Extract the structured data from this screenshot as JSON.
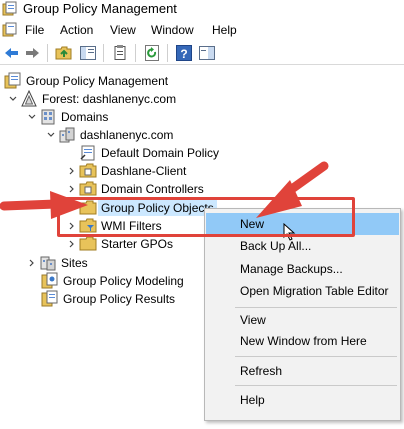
{
  "window": {
    "title": "Group Policy Management"
  },
  "menubar": {
    "items": [
      "File",
      "Action",
      "View",
      "Window",
      "Help"
    ]
  },
  "toolbar": {
    "icons": [
      "back-arrow-icon",
      "forward-arrow-icon",
      "up-folder-icon",
      "show-hide-tree-icon",
      "properties-icon",
      "refresh-icon",
      "help-icon",
      "action-pane-icon"
    ]
  },
  "tree": {
    "root": "Group Policy Management",
    "forest": "Forest: dashlanenyc.com",
    "domains": "Domains",
    "domain": "dashlanenyc.com",
    "default_policy": "Default Domain Policy",
    "dashlane_client": "Dashlane-Client",
    "domain_controllers": "Domain Controllers",
    "gpo": "Group Policy Objects",
    "wmi": "WMI Filters",
    "starter": "Starter GPOs",
    "sites": "Sites",
    "modeling": "Group Policy Modeling",
    "results": "Group Policy Results"
  },
  "context_menu": {
    "items": [
      "New",
      "Back Up All...",
      "Manage Backups...",
      "Open Migration Table Editor",
      "View",
      "New Window from Here",
      "Refresh",
      "Help"
    ],
    "highlighted": "New"
  },
  "colors": {
    "annotation": "#e0433a",
    "menu_hover": "#91c9f7",
    "selection": "#cce8ff"
  }
}
